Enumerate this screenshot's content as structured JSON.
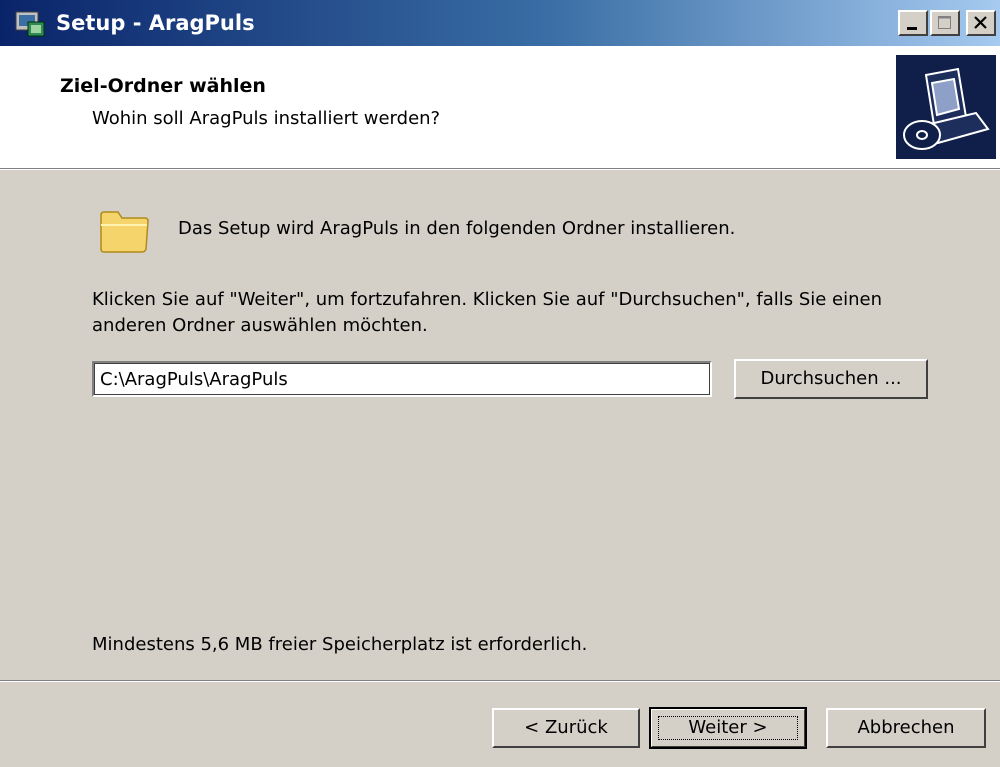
{
  "window": {
    "title": "Setup - AragPuls",
    "controls": [
      "minimize",
      "maximize",
      "close"
    ]
  },
  "header": {
    "title": "Ziel-Ordner wählen",
    "subtitle": "Wohin soll AragPuls installiert werden?",
    "image_icon": "computer-disc-icon"
  },
  "body": {
    "folder_icon": "folder-icon",
    "intro": "Das Setup wird AragPuls in den folgenden Ordner installieren.",
    "instruction_line1": "Klicken Sie auf \"Weiter\", um fortzufahren. Klicken Sie auf \"Durchsuchen\", falls Sie einen",
    "instruction_line2": "anderen Ordner auswählen möchten.",
    "path_value": "C:\\AragPuls\\AragPuls",
    "browse_label": "Durchsuchen ...",
    "disk_space": "Mindestens 5,6 MB freier Speicherplatz ist erforderlich."
  },
  "buttons": {
    "back": "< Zurück",
    "next": "Weiter >",
    "cancel": "Abbrechen"
  },
  "colors": {
    "title_bar_start": "#0a246a",
    "title_bar_end": "#a6caf0",
    "face": "#d4d0c8",
    "folder": "#f5d56b"
  }
}
